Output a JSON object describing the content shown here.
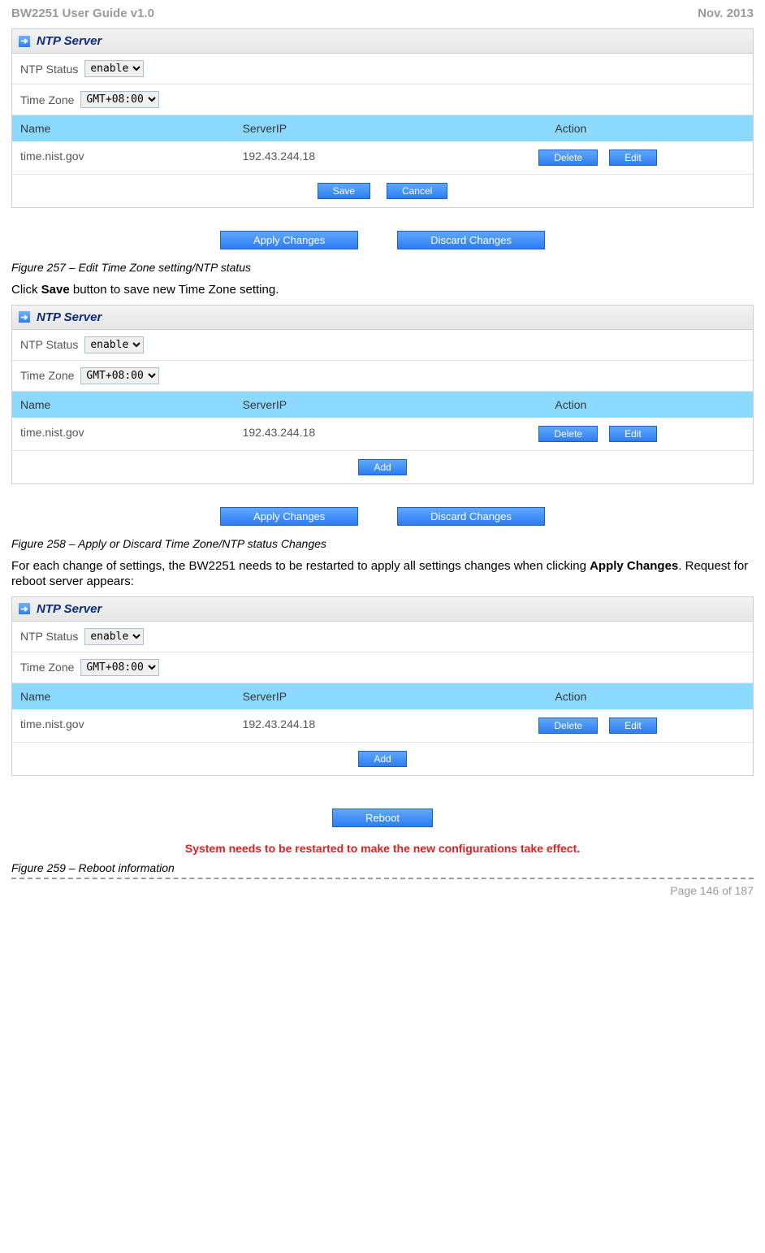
{
  "header": {
    "left": "BW2251 User Guide v1.0",
    "right": "Nov.  2013"
  },
  "footer": {
    "page": "Page 146 of 187"
  },
  "panel": {
    "title": "NTP Server",
    "status_label": "NTP Status",
    "status_value": "enable",
    "tz_label": "Time Zone",
    "tz_value": "GMT+08:00",
    "columns": {
      "name": "Name",
      "ip": "ServerIP",
      "action": "Action"
    },
    "row": {
      "name": "time.nist.gov",
      "ip": "192.43.244.18"
    },
    "buttons": {
      "delete": "Delete",
      "edit": "Edit",
      "save": "Save",
      "cancel": "Cancel",
      "add": "Add"
    }
  },
  "bar": {
    "apply": "Apply Changes",
    "discard": "Discard Changes",
    "reboot": "Reboot"
  },
  "captions": {
    "fig257": "Figure 257 – Edit Time Zone setting/NTP status",
    "fig258": "Figure 258 – Apply or Discard Time Zone/NTP status Changes",
    "fig259": "Figure 259 – Reboot information"
  },
  "text": {
    "click_save_pre": "Click ",
    "click_save_bold": "Save",
    "click_save_post": " button to save new Time Zone setting.",
    "apply_pre": "For each change of settings, the BW2251 needs to be restarted to apply all settings changes when clicking ",
    "apply_bold": "Apply Changes",
    "apply_post": ". Request for reboot server appears:"
  },
  "reboot_msg": "System needs to be restarted to make the new configurations take effect."
}
